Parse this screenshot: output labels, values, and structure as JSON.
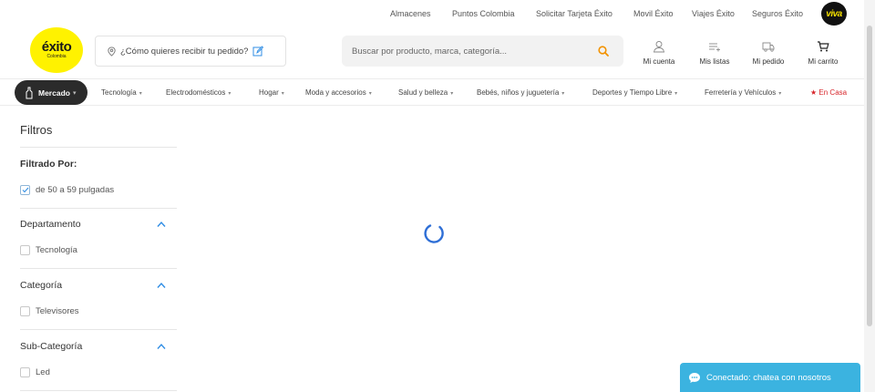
{
  "util_links": [
    "Almacenes",
    "Puntos Colombia",
    "Solicitar Tarjeta Éxito",
    "Movil Éxito",
    "Viajes Éxito",
    "Seguros Éxito"
  ],
  "viva_logo": "viva",
  "logo": {
    "word": "éxito",
    "sub": "Colombia"
  },
  "delivery": {
    "text": "¿Cómo quieres recibir tu pedido?"
  },
  "search": {
    "placeholder": "Buscar por producto, marca, categoría..."
  },
  "header_actions": [
    {
      "label": "Mi cuenta",
      "icon": "user-icon"
    },
    {
      "label": "Mis listas",
      "icon": "list-icon"
    },
    {
      "label": "Mi pedido",
      "icon": "truck-icon"
    },
    {
      "label": "Mi carrito",
      "icon": "cart-icon"
    }
  ],
  "categories": {
    "mercado": "Mercado",
    "items": [
      "Tecnología",
      "Electrodomésticos",
      "Hogar",
      "Moda y accesorios",
      "Salud y belleza",
      "Bebés, niños y juguetería",
      "Deportes y Tiempo Libre",
      "Ferretería y Vehículos"
    ],
    "en_casa": "En Casa"
  },
  "filters": {
    "title": "Filtros",
    "filtered_by": {
      "title": "Filtrado Por:",
      "option": "de 50 a 59 pulgadas"
    },
    "sections": [
      {
        "title": "Departamento",
        "option": "Tecnología"
      },
      {
        "title": "Categoría",
        "option": "Televisores"
      },
      {
        "title": "Sub-Categoría",
        "option": "Led"
      }
    ]
  },
  "chat": {
    "label": "Conectado: chatea con nosotros"
  },
  "colors": {
    "brand_yellow": "#fff200",
    "accent_orange": "#f39200",
    "chat_blue": "#3bb3e0",
    "spinner_blue": "#2f6fd6",
    "en_casa_red": "#d7262b"
  }
}
